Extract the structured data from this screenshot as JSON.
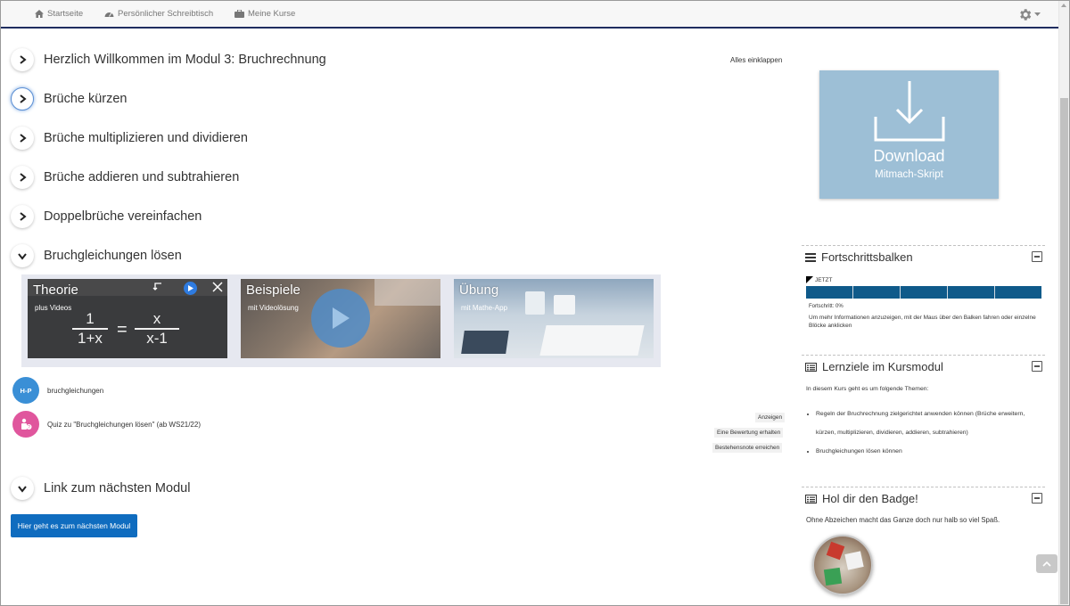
{
  "nav": {
    "home": "Startseite",
    "dashboard": "Persönlicher Schreibtisch",
    "courses": "Meine Kurse"
  },
  "course": {
    "collapse_all": "Alles einklappen",
    "sections": [
      {
        "title": "Herzlich Willkommen im Modul 3: Bruchrechnung",
        "state": "collapsed"
      },
      {
        "title": "Brüche kürzen",
        "state": "collapsed"
      },
      {
        "title": "Brüche multiplizieren und dividieren",
        "state": "collapsed"
      },
      {
        "title": "Brüche addieren und subtrahieren",
        "state": "collapsed"
      },
      {
        "title": "Doppelbrüche vereinfachen",
        "state": "collapsed"
      },
      {
        "title": "Bruchgleichungen lösen",
        "state": "expanded"
      },
      {
        "title": "Link zum nächsten Modul",
        "state": "expanded"
      }
    ],
    "banner": {
      "tiles": [
        {
          "title": "Theorie",
          "subtitle": "plus Videos",
          "formula_top_left": "1",
          "formula_bottom_left": "1+x",
          "formula_eq": "=",
          "formula_top_right": "x",
          "formula_bottom_right": "x-1"
        },
        {
          "title": "Beispiele",
          "subtitle": "mit Videolösung"
        },
        {
          "title": "Übung",
          "subtitle": "mit Mathe-App"
        }
      ]
    },
    "activities": [
      {
        "name": "bruchgleichungen",
        "icon": "h5p-icon",
        "icon_text": "H-P",
        "color": "#3a8fd6"
      },
      {
        "name": "Quiz zu \"Bruchgleichungen lösen\" (ab WS21/22)",
        "icon": "quiz-icon",
        "color": "#e0569d"
      }
    ],
    "quiz_conditions": [
      "Anzeigen",
      "Eine Bewertung erhalten",
      "Bestehensnote erreichen"
    ],
    "next_button": "Hier geht es zum nächsten Modul"
  },
  "sidebar": {
    "download": {
      "label": "Download",
      "sub": "Mitmach-Skript"
    },
    "progress": {
      "title": "Fortschrittsbalken",
      "now_marker": "JETZT",
      "progress_text": "Fortschritt: 0%",
      "progress_value": 0,
      "info": "Um mehr Informationen anzuzeigen, mit der Maus über den Balken fahren oder einzelne Blöcke anklicken"
    },
    "goals": {
      "title": "Lernziele im Kursmodul",
      "intro": "In diesem Kurs geht es um folgende Themen:",
      "items": [
        "Regeln der Bruchrechnung zielgerichtet anwenden können (Brüche erweitern, kürzen, multiplizieren, dividieren, addieren, subtrahieren)",
        "Bruchgleichungen lösen können"
      ]
    },
    "badge": {
      "title": "Hol dir den Badge!",
      "text": "Ohne Abzeichen macht das Ganze doch nur halb so viel Spaß."
    }
  },
  "colors": {
    "navbar_border": "#1f2d5f",
    "primary_button": "#0f6cbf",
    "progress_bar": "#0f5a8a",
    "download_tile": "#9dbfd6"
  }
}
